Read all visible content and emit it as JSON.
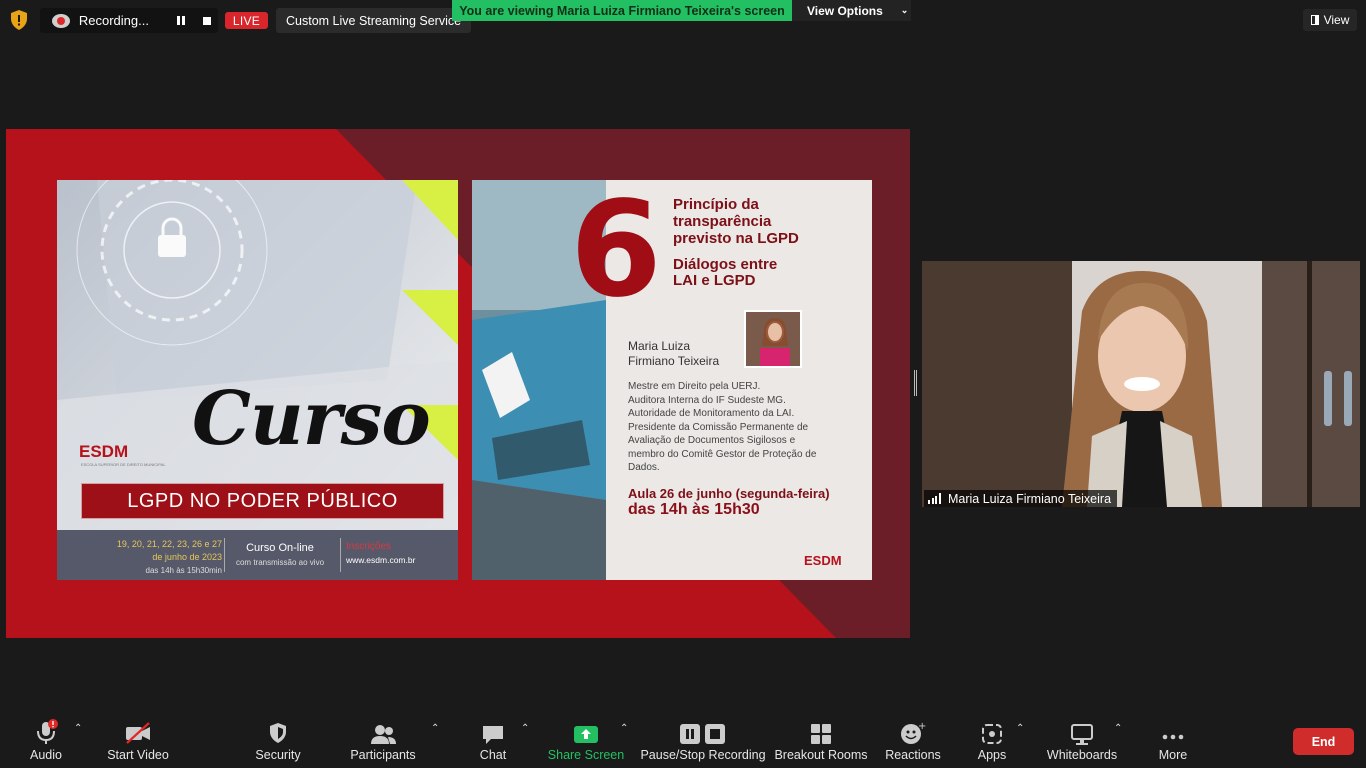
{
  "topbar": {
    "recording_label": "Recording...",
    "live_label": "LIVE",
    "stream_service": "Custom Live Streaming Service",
    "viewing_banner": "You are viewing Maria Luiza Firmiano Teixeira's screen",
    "view_options_label": "View Options",
    "view_label": "View"
  },
  "slide_left": {
    "title": "Curso",
    "logo": "ESDM",
    "logo_sub": "ESCOLA SUPERIOR DE DIREITO MUNICIPAL",
    "banner": "LGPD NO PODER PÚBLICO",
    "dates_line1": "19, 20, 21, 22, 23, 26 e 27",
    "dates_line2": "de junho de 2023",
    "dates_line3": "das 14h às 15h30min",
    "online_title": "Curso On-line",
    "online_sub": "com transmissão ao vivo",
    "inscricoes": "Inscrições",
    "url": "www.esdm.com.br"
  },
  "slide_right": {
    "number": "6",
    "title_1": "Princípio da",
    "title_2": "transparência",
    "title_3": "previsto na LGPD",
    "subtitle_1": "Diálogos entre",
    "subtitle_2": "LAI e LGPD",
    "speaker_1": "Maria Luiza",
    "speaker_2": "Firmiano Teixeira",
    "bio_1": "Mestre em Direito pela UERJ.",
    "bio_2": "Auditora Interna do IF Sudeste MG.",
    "bio_3": "Autoridade de Monitoramento da LAI.",
    "bio_4": "Presidente da Comissão Permanente de",
    "bio_5": "Avaliação de Documentos Sigilosos e",
    "bio_6": "membro do Comitê Gestor de Proteção de",
    "bio_7": "Dados.",
    "aula": "Aula 26 de junho (segunda-feira)",
    "horario": "das 14h às 15h30",
    "logo": "ESDM"
  },
  "video": {
    "participant_name": "Maria Luiza Firmiano Teixeira"
  },
  "toolbar": {
    "audio": "Audio",
    "start_video": "Start Video",
    "security": "Security",
    "participants": "Participants",
    "chat": "Chat",
    "share_screen": "Share Screen",
    "pause_stop_recording": "Pause/Stop Recording",
    "breakout_rooms": "Breakout Rooms",
    "reactions": "Reactions",
    "apps": "Apps",
    "whiteboards": "Whiteboards",
    "more": "More",
    "end": "End"
  },
  "colors": {
    "live_red": "#d9262c",
    "banner_green": "#23c063",
    "share_green": "#23c063",
    "end_red": "#d12c2c",
    "slide_red": "#b5121b"
  },
  "icons": [
    "shield-icon",
    "recording-icon",
    "pause-icon",
    "stop-icon",
    "view-icon",
    "mic-icon",
    "video-off-icon",
    "security-icon",
    "participants-icon",
    "chat-icon",
    "share-screen-icon",
    "pause-recording-icon",
    "stop-recording-icon",
    "breakout-rooms-icon",
    "reactions-icon",
    "apps-icon",
    "whiteboards-icon",
    "more-icon",
    "signal-icon"
  ]
}
